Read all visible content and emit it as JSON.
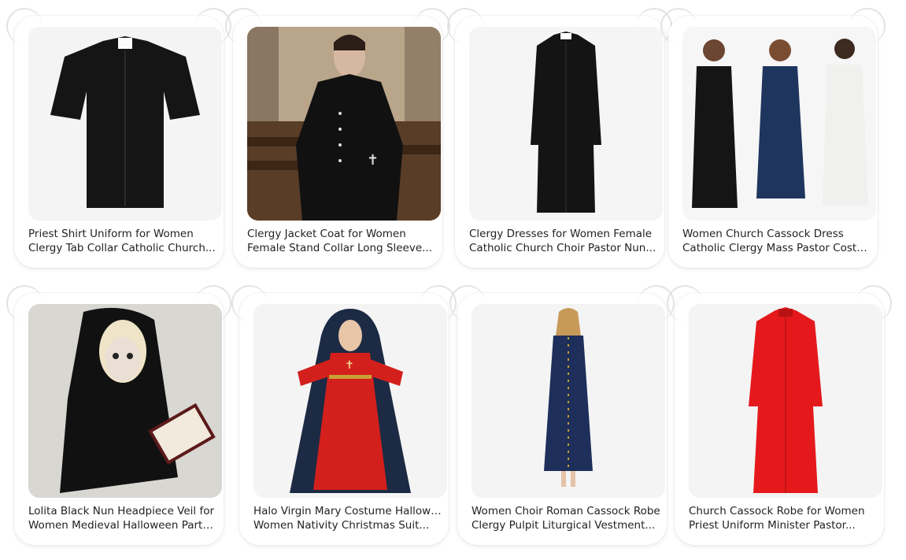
{
  "products": [
    {
      "line1": "Priest Shirt Uniform for Women",
      "line2": "Clergy Tab Collar Catholic Church...",
      "image": "black-short-sleeve-clergy-shirt"
    },
    {
      "line1": "Clergy Jacket Coat for Women",
      "line2": "Female Stand Collar Long Sleeve...",
      "image": "woman-in-black-clergy-jacket-in-church"
    },
    {
      "line1": "Clergy Dresses for Women Female",
      "line2": "Catholic Church Choir Pastor Nun...",
      "image": "black-clergy-dress"
    },
    {
      "line1": "Women Church Cassock Dress",
      "line2": "Catholic Clergy Mass Pastor Costume",
      "image": "three-women-in-cassocks"
    },
    {
      "line1": "Lolita Black Nun Headpiece Veil for",
      "line2": "Women Medieval Halloween Party...",
      "image": "gothic-nun-with-book"
    },
    {
      "line1": "Halo Virgin Mary Costume Halloween",
      "line2": "Women Nativity Christmas Suit...",
      "image": "red-virgin-mary-costume"
    },
    {
      "line1": "Women Choir Roman Cassock Robe",
      "line2": "Clergy Pulpit Liturgical Vestment...",
      "image": "woman-in-navy-cassock"
    },
    {
      "line1": "Church Cassock Robe for Women",
      "line2": "Priest Uniform Minister Pastor...",
      "image": "red-cassock-robe"
    }
  ]
}
